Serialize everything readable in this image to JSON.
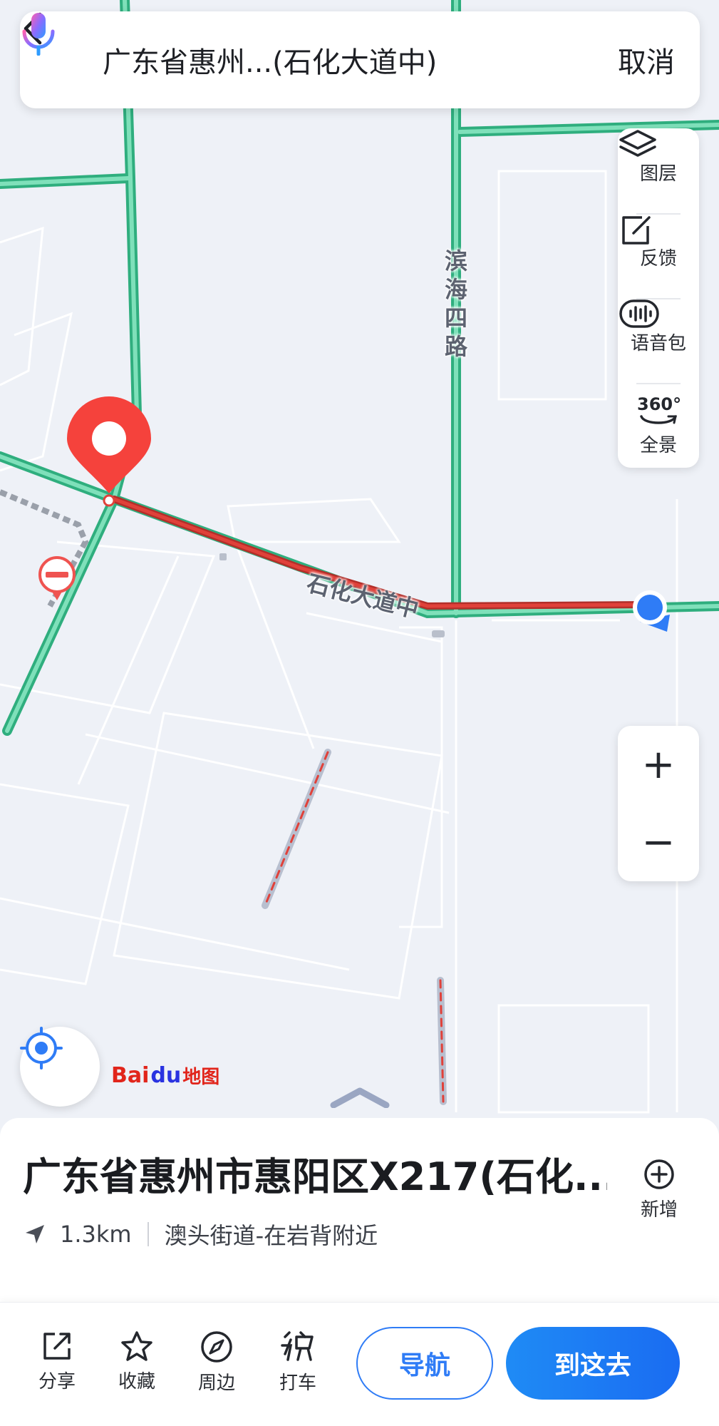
{
  "search_bar": {
    "query": "广东省惠州...(石化大道中)",
    "cancel_label": "取消",
    "back_icon": "chevron-left-icon",
    "mic_icon": "microphone-icon"
  },
  "map": {
    "road_labels": {
      "vertical": "滨海四路",
      "main": "石化大道中"
    },
    "colors": {
      "road_green": "#46c79a",
      "congestion_red": "#e0413a",
      "pin_red": "#f5423c",
      "location_blue": "#2f7cf6"
    }
  },
  "side_tools": [
    {
      "icon": "layers-icon",
      "label": "图层"
    },
    {
      "icon": "feedback-edit-icon",
      "label": "反馈"
    },
    {
      "icon": "voice-pack-icon",
      "label": "语音包"
    },
    {
      "icon": "panorama-360-icon",
      "label": "全景",
      "glyph": "360°"
    }
  ],
  "zoom": {
    "in_label": "+",
    "out_label": "−"
  },
  "logo": {
    "brand": "Bai",
    "paw": "du",
    "suffix": "地图"
  },
  "poi": {
    "title": "广东省惠州市惠阳区X217(石化...",
    "distance": "1.3km",
    "address": "澳头街道-在岩背附近",
    "add_label": "新增"
  },
  "actions": {
    "share": "分享",
    "favorite": "收藏",
    "nearby": "周边",
    "taxi": "打车",
    "navigate": "导航",
    "go_here": "到这去"
  }
}
